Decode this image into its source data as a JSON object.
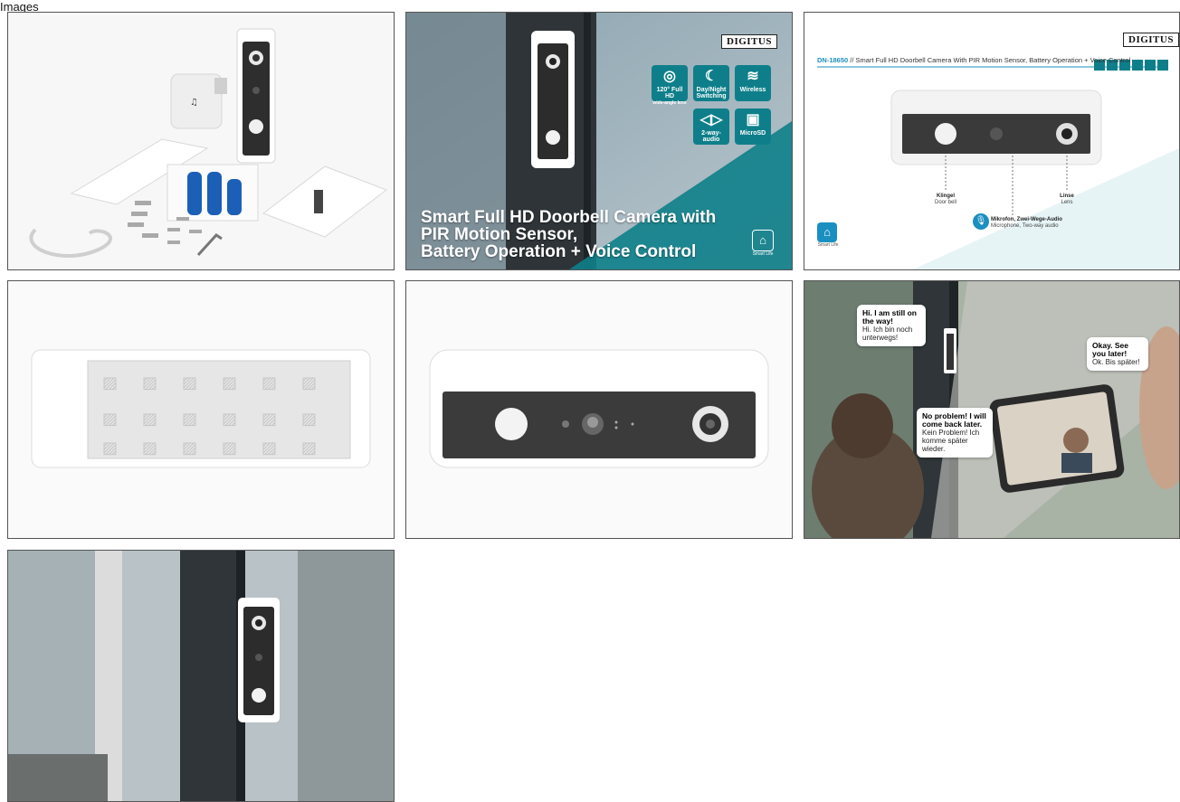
{
  "header": {
    "title": "Images"
  },
  "tiles": {
    "t2": {
      "brand": "DIGITUS",
      "headline": [
        "Smart Full HD Doorbell Camera with",
        "PIR Motion Sensor,",
        "Battery Operation + Voice Control"
      ],
      "features": [
        {
          "icon": "lens-icon",
          "label": "120° Full HD",
          "sub": "wide-angle lens"
        },
        {
          "icon": "moon-icon",
          "label": "Day/Night",
          "sub": "Switching"
        },
        {
          "icon": "wifi-icon",
          "label": "Wireless",
          "sub": ""
        },
        {
          "icon": "audio-icon",
          "label": "2-way-audio",
          "sub": ""
        },
        {
          "icon": "sd-card-icon",
          "label": "MicroSD",
          "sub": ""
        }
      ],
      "app_label": "Smart Life"
    },
    "t3": {
      "brand": "DIGITUS",
      "model": "DN-18650",
      "title": "// Smart Full HD Doorbell Camera With PIR Motion Sensor, Battery Operation + Voice Control",
      "callouts": [
        {
          "de": "Klingel",
          "en": "Door bell"
        },
        {
          "de": "Linse",
          "en": "Lens"
        },
        {
          "de": "Mikrofon, Zwei-Wege-Audio",
          "en": "Microphone, Two-way audio"
        }
      ],
      "app_label": "Smart Life"
    },
    "t6": {
      "bubbles": [
        {
          "en": "Hi. I am still on the way!",
          "de": "Hi. Ich bin noch unterwegs!"
        },
        {
          "en": "Okay. See you later!",
          "de": "Ok. Bis später!"
        },
        {
          "en": "No problem! I will come back later.",
          "de": "Kein Problem! Ich komme später wieder."
        }
      ]
    }
  },
  "colors": {
    "accent": "#0e7f8a",
    "model_blue": "#1a8fc0"
  }
}
